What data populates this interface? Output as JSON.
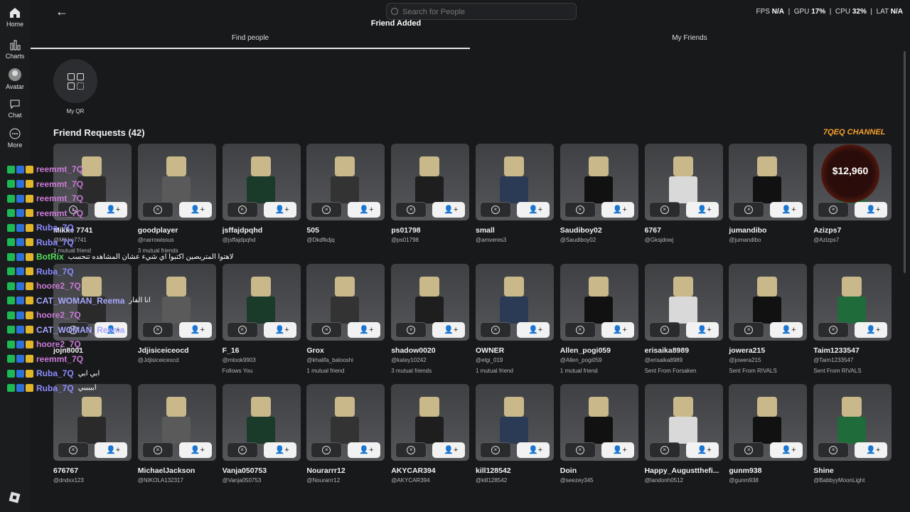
{
  "nav": {
    "home": "Home",
    "charts": "Charts",
    "avatar": "Avatar",
    "chat": "Chat",
    "more": "More"
  },
  "search": {
    "placeholder": "Search for People"
  },
  "toast": "Friend Added",
  "stats": {
    "fps_label": "FPS",
    "fps": "N/A",
    "gpu_label": "GPU",
    "gpu": "17%",
    "cpu_label": "CPU",
    "cpu": "32%",
    "lat_label": "LAT",
    "lat": "N/A"
  },
  "tabs": {
    "find": "Find people",
    "friends": "My Friends"
  },
  "qr": {
    "label": "My QR"
  },
  "requests_title": "Friend Requests (42)",
  "cards": [
    {
      "name": "Mikke 7741",
      "handle": "@Mikke7741",
      "sub": "1 mutual friend"
    },
    {
      "name": "goodplayer",
      "handle": "@narrowissus",
      "sub": "3 mutual friends"
    },
    {
      "name": "jsffajdpqhd",
      "handle": "@jsffajdpqhd",
      "sub": ""
    },
    {
      "name": "505",
      "handle": "@Dkdfkdjq",
      "sub": ""
    },
    {
      "name": "ps01798",
      "handle": "@ps01798",
      "sub": ""
    },
    {
      "name": "small",
      "handle": "@amveres3",
      "sub": ""
    },
    {
      "name": "Saudiboy02",
      "handle": "@Saudiboy02",
      "sub": ""
    },
    {
      "name": "6767",
      "handle": "@Gksjdowj",
      "sub": ""
    },
    {
      "name": "jumandibo",
      "handle": "@jumandibo",
      "sub": ""
    },
    {
      "name": "Azizps7",
      "handle": "@Azizps7",
      "sub": ""
    },
    {
      "name": "jojn8001",
      "handle": "",
      "sub": ""
    },
    {
      "name": "Jdjisiceiceocd",
      "handle": "@Jdjisiceiceocd",
      "sub": ""
    },
    {
      "name": "F_16",
      "handle": "@mlook9903",
      "sub": "Follows You"
    },
    {
      "name": "Grox",
      "handle": "@khalifa_balooshi",
      "sub": "1 mutual friend"
    },
    {
      "name": "shadow0020",
      "handle": "@katey10242",
      "sub": "3 mutual friends"
    },
    {
      "name": "OWNER",
      "handle": "@elgi_019",
      "sub": "1 mutual friend"
    },
    {
      "name": "Allen_pogi059",
      "handle": "@Allen_pogi059",
      "sub": "1 mutual friend"
    },
    {
      "name": "erisaika8989",
      "handle": "@erisaika8989",
      "sub": "Sent From Forsaken"
    },
    {
      "name": "jowera215",
      "handle": "@jowera215",
      "sub": "Sent From RIVALS"
    },
    {
      "name": "Taim1233547",
      "handle": "@Taim1233547",
      "sub": "Sent From RIVALS"
    },
    {
      "name": "676767",
      "handle": "@dndxx123",
      "sub": ""
    },
    {
      "name": "MichaelJackson",
      "handle": "@NIKOLA132317",
      "sub": ""
    },
    {
      "name": "Vanja050753",
      "handle": "@Vanja050753",
      "sub": ""
    },
    {
      "name": "Nourarrr12",
      "handle": "@Nourarrr12",
      "sub": ""
    },
    {
      "name": "AKYCAR394",
      "handle": "@AKYCAR394",
      "sub": ""
    },
    {
      "name": "kill128542",
      "handle": "@kill128542",
      "sub": ""
    },
    {
      "name": "Doin",
      "handle": "@seezey345",
      "sub": ""
    },
    {
      "name": "Happy_Augustthefi...",
      "handle": "@landonh0512",
      "sub": ""
    },
    {
      "name": "gunm938",
      "handle": "@gunm938",
      "sub": ""
    },
    {
      "name": "Shine",
      "handle": "@BabbyyMoonLight",
      "sub": ""
    }
  ],
  "colors": {
    "accent": "#e6e6e6",
    "background": "#18191b",
    "card": "#4a4b4e"
  },
  "overlay": {
    "channel_logo": "7QEQ CHANNEL",
    "coin_amount": "$12,960",
    "chat": [
      {
        "user": "reemmt_7Q",
        "color": "#c97bd6",
        "msg": ""
      },
      {
        "user": "reemmt_7Q",
        "color": "#c97bd6",
        "msg": ""
      },
      {
        "user": "reemmt_7Q",
        "color": "#c97bd6",
        "msg": ""
      },
      {
        "user": "reemmt_7Q",
        "color": "#c97bd6",
        "msg": ""
      },
      {
        "user": "Ruba_7Q",
        "color": "#8c8cff",
        "msg": ""
      },
      {
        "user": "Ruba_7Q",
        "color": "#8c8cff",
        "msg": ""
      },
      {
        "user": "BotRix",
        "color": "#57e05c",
        "msg": "لاهتوا المتربصين اكتبوا اي شيء عشان المشاهده تنحسب"
      },
      {
        "user": "Ruba_7Q",
        "color": "#8c8cff",
        "msg": ""
      },
      {
        "user": "hoore2_7Q",
        "color": "#c97bd6",
        "msg": ""
      },
      {
        "user": "CAT_WOMAN_Reema",
        "color": "#a8a8ff",
        "msg": "انا الفار"
      },
      {
        "user": "hoore2_7Q",
        "color": "#c97bd6",
        "msg": ""
      },
      {
        "user": "CAT_WOMAN_Reema",
        "color": "#a8a8ff",
        "msg": ""
      },
      {
        "user": "hoore2_7Q",
        "color": "#c97bd6",
        "msg": ""
      },
      {
        "user": "reemmt_7Q",
        "color": "#c97bd6",
        "msg": ""
      },
      {
        "user": "Ruba_7Q",
        "color": "#8c8cff",
        "msg": "ابي ابي"
      },
      {
        "user": "Ruba_7Q",
        "color": "#8c8cff",
        "msg": "ابببببي"
      }
    ]
  }
}
